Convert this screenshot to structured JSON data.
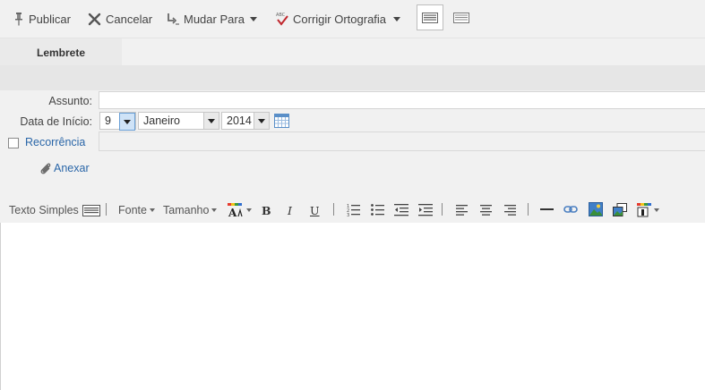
{
  "toolbar": {
    "publish_label": "Publicar",
    "cancel_label": "Cancelar",
    "move_label": "Mudar Para",
    "spell_label": "Corrigir Ortografia"
  },
  "tabs": [
    {
      "label": "Lembrete"
    }
  ],
  "form": {
    "subject_label": "Assunto:",
    "subject_value": "",
    "start_date_label": "Data de Início:",
    "day_value": "9",
    "month_value": "Janeiro",
    "year_value": "2014",
    "recurrence_label": "Recorrência",
    "attach_label": "Anexar"
  },
  "format_toolbar": {
    "plain_text_label": "Texto Simples",
    "font_label": "Fonte",
    "size_label": "Tamanho"
  },
  "colors": {
    "link": "#2a66a8",
    "background": "#f1f1f1",
    "editor": "#ffffff"
  },
  "icons": [
    "pin-icon",
    "cancel-x-icon",
    "move-icon",
    "spellcheck-icon",
    "reading-pane-icon",
    "list-view-icon",
    "calendar-icon",
    "paperclip-icon",
    "plain-text-icon",
    "font-color-icon",
    "bold-icon",
    "italic-icon",
    "underline-icon",
    "numbered-list-icon",
    "bullet-list-icon",
    "outdent-icon",
    "indent-icon",
    "align-left-icon",
    "align-center-icon",
    "align-right-icon",
    "horizontal-rule-icon",
    "link-icon",
    "image-icon",
    "image-window-icon",
    "highlight-icon"
  ]
}
